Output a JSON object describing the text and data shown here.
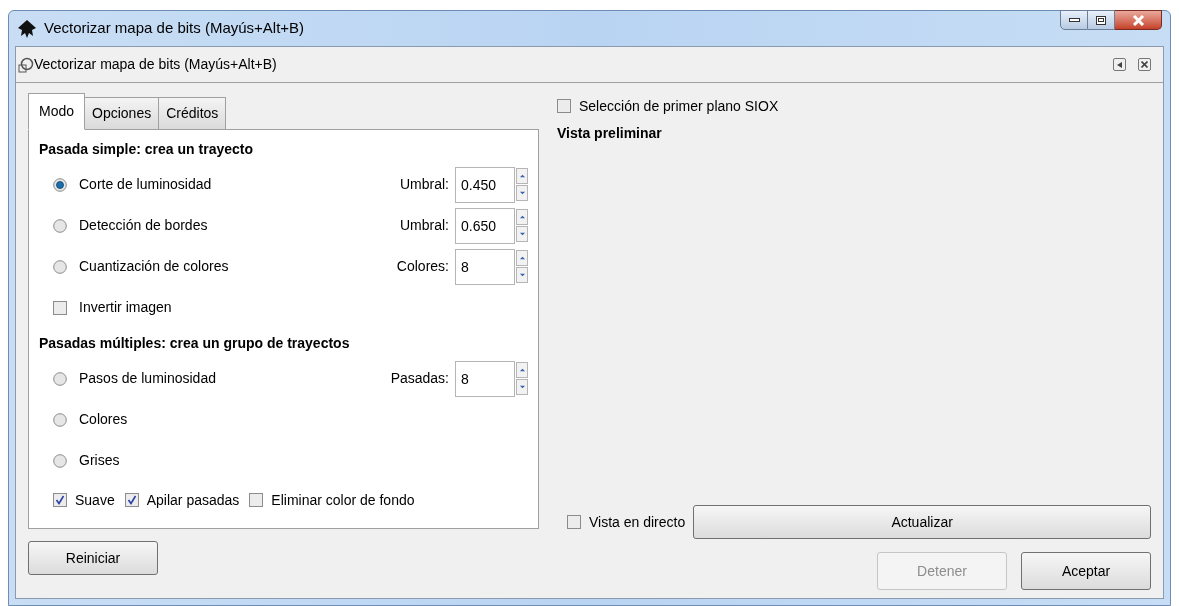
{
  "window": {
    "title": "Vectorizar mapa de bits (Mayús+Alt+B)"
  },
  "dialog": {
    "title": "Vectorizar mapa de bits (Mayús+Alt+B)"
  },
  "tabs": [
    {
      "label": "Modo",
      "selected": true
    },
    {
      "label": "Opciones",
      "selected": false
    },
    {
      "label": "Créditos",
      "selected": false
    }
  ],
  "single_scan": {
    "heading": "Pasada simple: crea un trayecto",
    "options": [
      {
        "kind": "radio",
        "label": "Corte de luminosidad",
        "selected": true,
        "field": {
          "label": "Umbral:",
          "value": "0.450"
        }
      },
      {
        "kind": "radio",
        "label": "Detección de bordes",
        "selected": false,
        "field": {
          "label": "Umbral:",
          "value": "0.650"
        }
      },
      {
        "kind": "radio",
        "label": "Cuantización de colores",
        "selected": false,
        "field": {
          "label": "Colores:",
          "value": "8"
        }
      },
      {
        "kind": "checkbox",
        "label": "Invertir imagen",
        "checked": false
      }
    ]
  },
  "multiple_scans": {
    "heading": "Pasadas múltiples: crea un grupo de trayectos",
    "options": [
      {
        "kind": "radio",
        "label": "Pasos de luminosidad",
        "selected": false,
        "field": {
          "label": "Pasadas:",
          "value": "8"
        }
      },
      {
        "kind": "radio",
        "label": "Colores",
        "selected": false
      },
      {
        "kind": "radio",
        "label": "Grises",
        "selected": false
      }
    ],
    "checkboxes": [
      {
        "label": "Suave",
        "checked": true
      },
      {
        "label": "Apilar pasadas",
        "checked": true
      },
      {
        "label": "Eliminar color de fondo",
        "checked": false
      }
    ]
  },
  "siox": {
    "label": "Selección de primer plano SIOX",
    "checked": false
  },
  "preview": {
    "heading": "Vista preliminar",
    "live": {
      "label": "Vista en directo",
      "checked": false
    },
    "update_button": {
      "label": "Actualizar"
    }
  },
  "buttons": [
    {
      "label": "Reiniciar",
      "disabled": false
    },
    {
      "label": "Detener",
      "disabled": true
    },
    {
      "label": "Aceptar",
      "disabled": false
    }
  ]
}
